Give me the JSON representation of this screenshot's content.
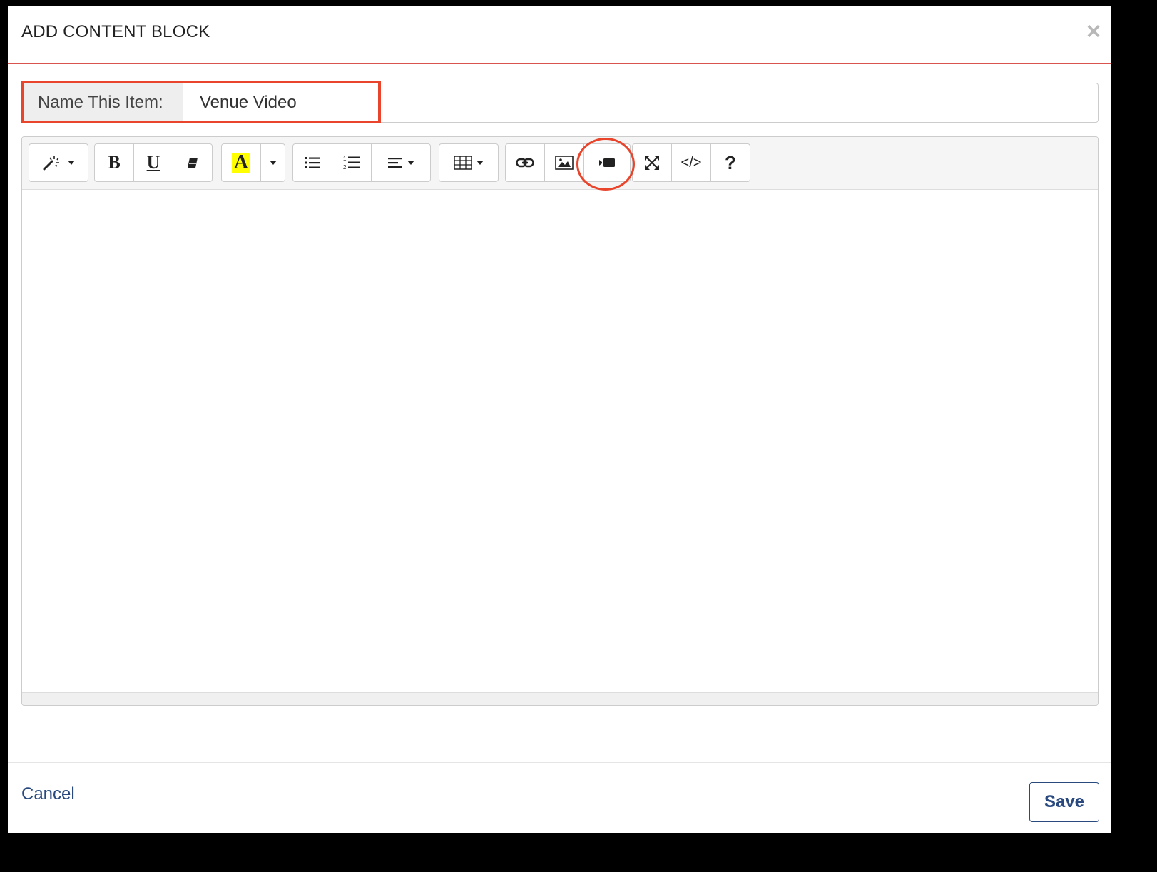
{
  "modal": {
    "title": "ADD CONTENT BLOCK",
    "close_icon": "close-icon"
  },
  "name_field": {
    "label": "Name This Item:",
    "value": "Venue Video"
  },
  "toolbar": {
    "groups": [
      {
        "buttons": [
          "magic-wand-icon"
        ]
      },
      {
        "buttons": [
          "bold-icon",
          "underline-icon",
          "eraser-icon"
        ]
      },
      {
        "buttons": [
          "font-color-icon",
          "color-dropdown-icon"
        ]
      },
      {
        "buttons": [
          "unordered-list-icon",
          "ordered-list-icon",
          "align-icon"
        ]
      },
      {
        "buttons": [
          "table-icon"
        ]
      },
      {
        "buttons": [
          "link-icon",
          "picture-icon",
          "video-icon"
        ]
      },
      {
        "buttons": [
          "fullscreen-icon",
          "code-view-icon",
          "help-icon"
        ]
      }
    ],
    "bold_glyph": "B",
    "underline_glyph": "U",
    "font_color_glyph": "A",
    "code_glyph": "</>",
    "help_glyph": "?"
  },
  "colors": {
    "accent": "#2a4a7f",
    "annotation": "#e8452c",
    "header_rule": "#d9534f",
    "highlight_yellow": "#ffff00"
  },
  "footer": {
    "cancel_label": "Cancel",
    "save_label": "Save"
  }
}
